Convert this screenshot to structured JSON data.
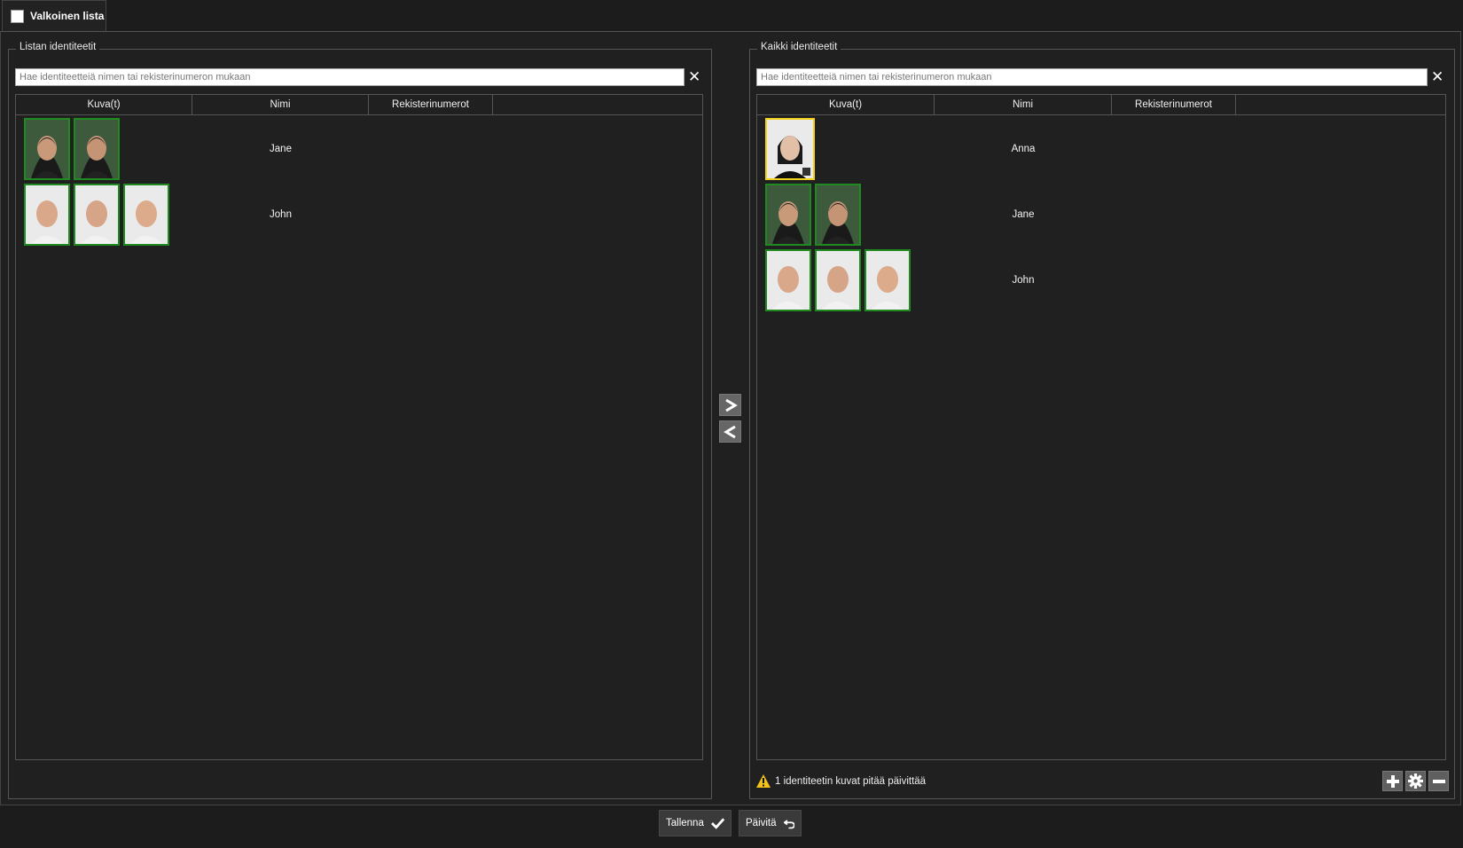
{
  "tab": {
    "title": "Valkoinen lista"
  },
  "left_panel": {
    "title": "Listan identiteetit",
    "search_placeholder": "Hae identiteetteiä nimen tai rekisterinumeron mukaan",
    "columns": [
      "Kuva(t)",
      "Nimi",
      "Rekisterinumerot"
    ],
    "rows": [
      {
        "name": "Jane",
        "photos": 2
      },
      {
        "name": "John",
        "photos": 3
      }
    ]
  },
  "right_panel": {
    "title": "Kaikki identiteetit",
    "search_placeholder": "Hae identiteetteiä nimen tai rekisterinumeron mukaan",
    "columns": [
      "Kuva(t)",
      "Nimi",
      "Rekisterinumerot"
    ],
    "rows": [
      {
        "name": "Anna",
        "photos": 1,
        "warning": true
      },
      {
        "name": "Jane",
        "photos": 2
      },
      {
        "name": "John",
        "photos": 3
      }
    ],
    "status_text": "1 identiteetin kuvat pitää päivittää"
  },
  "footer": {
    "save_label": "Tallenna",
    "refresh_label": "Päivitä"
  },
  "icons": {
    "move_right": "chevron-right-icon",
    "move_left": "chevron-left-icon",
    "clear": "close-icon",
    "warning": "warning-icon",
    "add": "plus-icon",
    "settings": "gear-icon",
    "remove": "minus-icon",
    "save": "check-icon",
    "refresh": "undo-icon"
  },
  "colors": {
    "ok_border": "#1f8a1f",
    "warning_border": "#f2d21b",
    "background": "#202020"
  }
}
